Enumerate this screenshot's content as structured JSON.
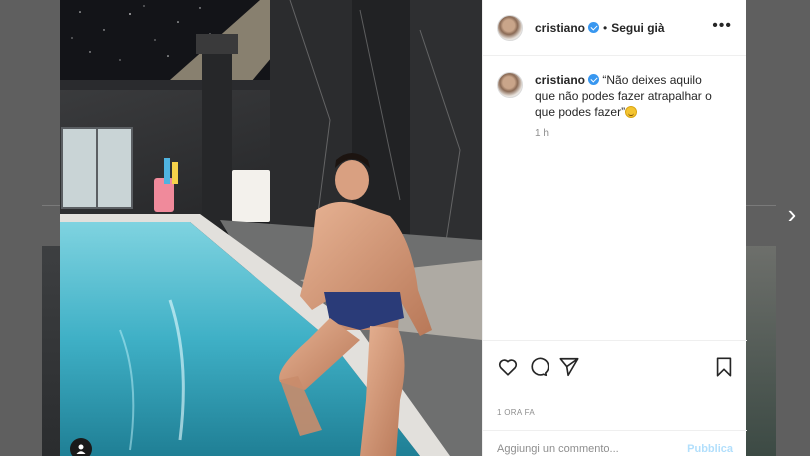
{
  "post": {
    "username": "cristiano",
    "verified": true,
    "separator": "•",
    "follow_label": "Segui già",
    "more_label": "•••",
    "caption_username": "cristiano",
    "caption_text": "“Não deixes aquilo que não podes fazer atrapalhar o que podes fazer”",
    "caption_time": "1 h",
    "date_label": "1 ORA FA"
  },
  "comment": {
    "placeholder": "Aggiungi un commento...",
    "publish_label": "Pubblica"
  },
  "navigation": {
    "next_label": "›"
  },
  "icons": {
    "like": "heart-icon",
    "comment": "speech-bubble-icon",
    "share": "paper-plane-icon",
    "save": "bookmark-icon",
    "tagged": "user-tag-icon",
    "verified": "verified-badge-icon",
    "more": "ellipsis-icon"
  },
  "colors": {
    "accent": "#3897f0",
    "publish_disabled": "#b2dffc",
    "text": "#262626",
    "secondary": "#8e8e8e"
  }
}
